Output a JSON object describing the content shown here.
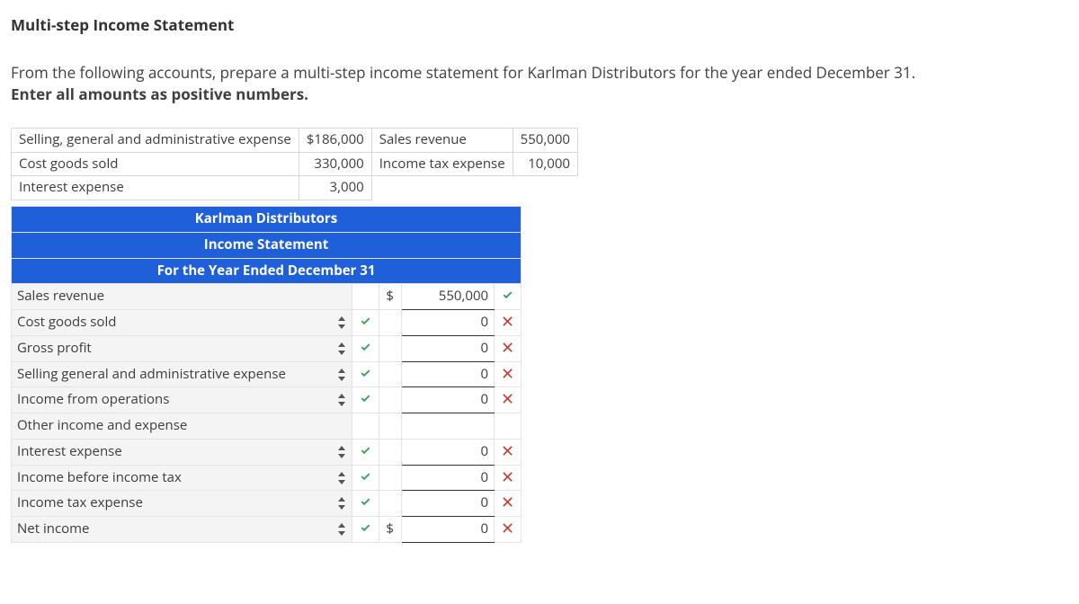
{
  "title": "Multi-step Income Statement",
  "instructions_line1": "From the following accounts, prepare a multi-step income statement for Karlman Distributors for the year ended December 31.",
  "instructions_line2": "Enter all amounts as positive numbers.",
  "given": {
    "r0c0": "Selling, general and administrative expense",
    "r0c1": "$186,000",
    "r0c2": "Sales revenue",
    "r0c3": "550,000",
    "r1c0": "Cost goods sold",
    "r1c1": "330,000",
    "r1c2": "Income tax expense",
    "r1c3": "10,000",
    "r2c0": "Interest expense",
    "r2c1": "3,000"
  },
  "stmt_header": {
    "l1": "Karlman Distributors",
    "l2": "Income Statement",
    "l3": "For the Year Ended December 31"
  },
  "rows": {
    "sales_revenue": {
      "label": "Sales revenue",
      "dollar": "$",
      "amount": "550,000"
    },
    "cogs": {
      "label": "Cost goods sold",
      "amount": "0"
    },
    "gross_profit": {
      "label": "Gross profit",
      "amount": "0"
    },
    "sga": {
      "label": "Selling general and administrative expense",
      "amount": "0"
    },
    "inc_ops": {
      "label": "Income from operations",
      "amount": "0"
    },
    "other": {
      "label": "Other income and expense"
    },
    "interest": {
      "label": "Interest expense",
      "amount": "0"
    },
    "before_tax": {
      "label": "Income before income tax",
      "amount": "0"
    },
    "tax": {
      "label": "Income tax expense",
      "amount": "0"
    },
    "net_income": {
      "label": "Net income",
      "dollar": "$",
      "amount": "0"
    }
  }
}
